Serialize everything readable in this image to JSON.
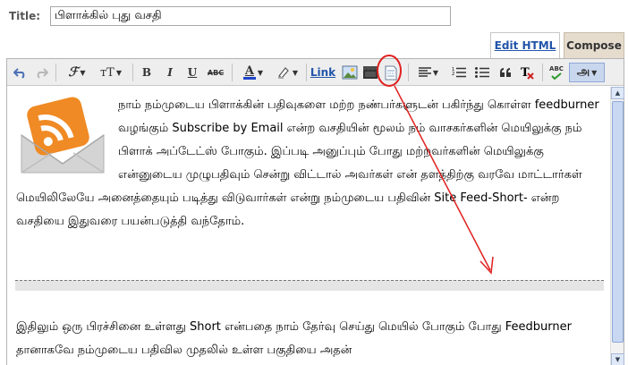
{
  "title_field": {
    "label": "Title:",
    "value": "பிளாக்கில் புது வசதி"
  },
  "tabs": {
    "edit_html": "Edit HTML",
    "compose": "Compose"
  },
  "toolbar": {
    "font_glyph": "ℱ",
    "size_glyph": "тT",
    "bold": "B",
    "italic": "I",
    "underline": "U",
    "strike": "ABC",
    "text_color": "A",
    "link": "Link",
    "spell": "ABC",
    "transliterate": "அ",
    "icons": [
      "undo-icon",
      "redo-icon",
      "font-icon",
      "font-size-icon",
      "bold-icon",
      "italic-icon",
      "underline-icon",
      "strikethrough-icon",
      "text-color-icon",
      "highlight-icon",
      "link-icon",
      "image-icon",
      "video-icon",
      "jump-break-icon",
      "align-icon",
      "numbered-list-icon",
      "bullet-list-icon",
      "quote-icon",
      "remove-format-icon",
      "spellcheck-icon",
      "transliterate-icon"
    ],
    "highlighted_button": "jump-break-icon",
    "colors": {
      "annotation": "#e0201f",
      "text_color_bar": "#1f44c8",
      "link": "#2255aa"
    }
  },
  "content": {
    "paragraph1": "நாம் நம்முடைய பிளாக்கின் பதிவுகளை மற்ற நண்பர்களுடன் பகிர்ந்து கொள்ள feedburner வழங்கும் Subscribe by Email என்ற வசதியின் மூலம் நம் வாசகர்களின் மெயிலுக்கு நம் பிளாக் அப்டேட்ஸ் போகும். இப்படி அனுப்பும் போது மற்றவர்களின் மெயிலுக்கு என்னுடைய முழுபதிவும் சென்று விட்டால் அவர்கள் என் தளத்திற்கு வரவே மாட்டார்கள் மெயிலிலேயே அனைத்தையும் படித்து விடுவார்கள் என்று நம்முடைய பதிவின் Site Feed-Short- என்ற வசதியை இதுவரை பயன்படுத்தி வந்தோம்.",
    "paragraph2": "இதிலும் ஒரு பிரச்சினை உள்ளது Short என்பதை நாம் தேர்வு செய்து மெயில் போகும் போது Feedburner தானாகவே நம்முடைய பதிவில முதலில் உள்ள பகுதியை அதன்"
  }
}
